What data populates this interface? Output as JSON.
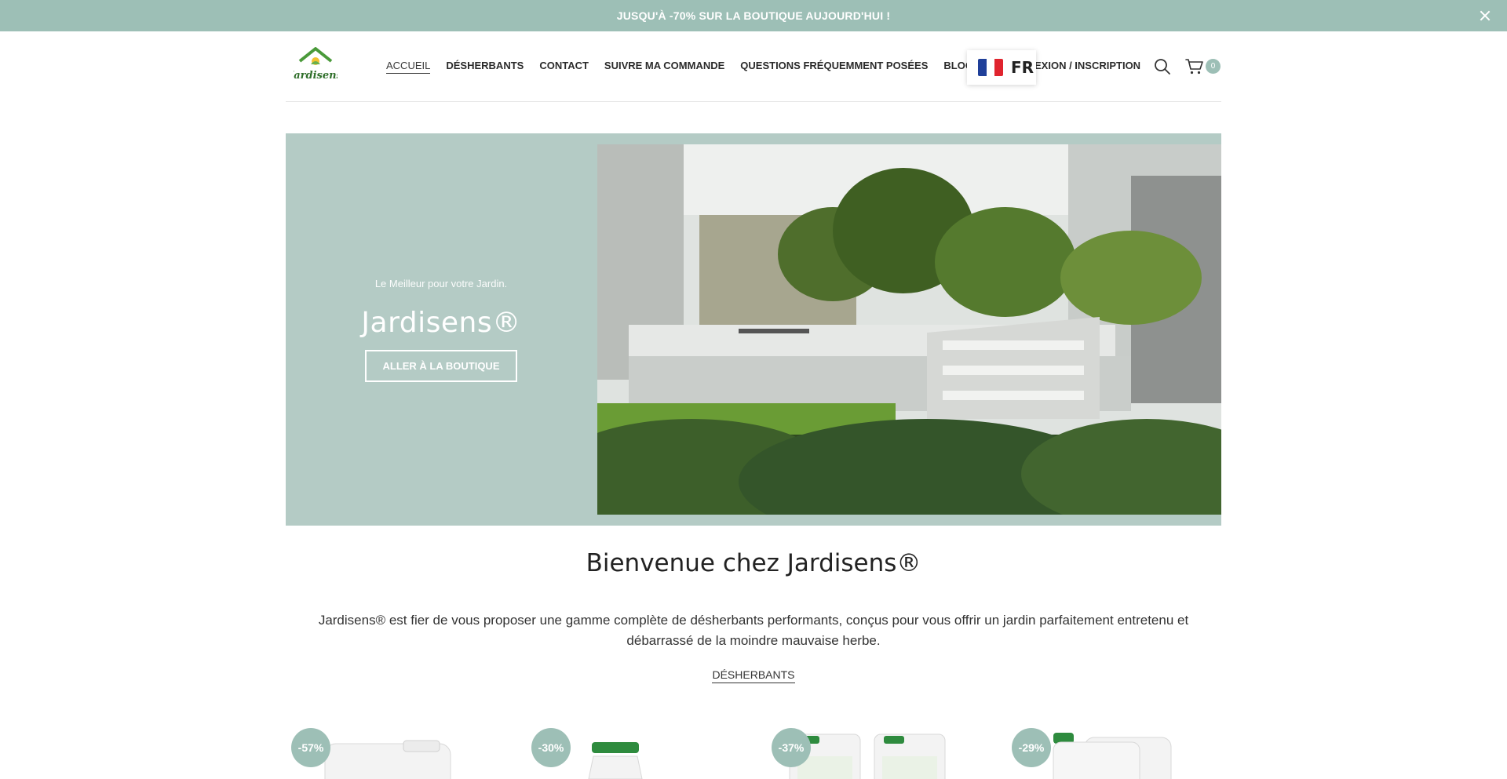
{
  "promo": {
    "text": "JUSQU'À -70% SUR LA BOUTIQUE AUJOURD'HUI !"
  },
  "header": {
    "logo_text": "Jardisens",
    "nav": [
      {
        "label": "ACCUEIL",
        "active": true
      },
      {
        "label": "DÉSHERBANTS"
      },
      {
        "label": "CONTACT"
      },
      {
        "label": "SUIVRE MA COMMANDE"
      },
      {
        "label": "QUESTIONS FRÉQUEMMENT POSÉES"
      },
      {
        "label": "BLOG"
      }
    ],
    "login_label": "EXION / INSCRIPTION",
    "language": "FR",
    "cart_count": "0"
  },
  "hero": {
    "subtitle": "Le Meilleur pour votre Jardin.",
    "title": "Jardisens®",
    "button": "ALLER À LA BOUTIQUE"
  },
  "welcome": {
    "title": "Bienvenue chez Jardisens®",
    "text": "Jardisens® est fier de vous proposer une gamme complète de désherbants performants, conçus pour vous offrir un jardin parfaitement entretenu et débarrassé de la moindre mauvaise herbe.",
    "category_link": "DÉSHERBANTS"
  },
  "products": [
    {
      "discount": "-57%"
    },
    {
      "discount": "-30%"
    },
    {
      "discount": "-37%"
    },
    {
      "discount": "-29%"
    }
  ],
  "colors": {
    "accent": "#9dbfb6",
    "hero_bg": "#b4cbc5",
    "bottle_cap": "#2e8b3e"
  }
}
